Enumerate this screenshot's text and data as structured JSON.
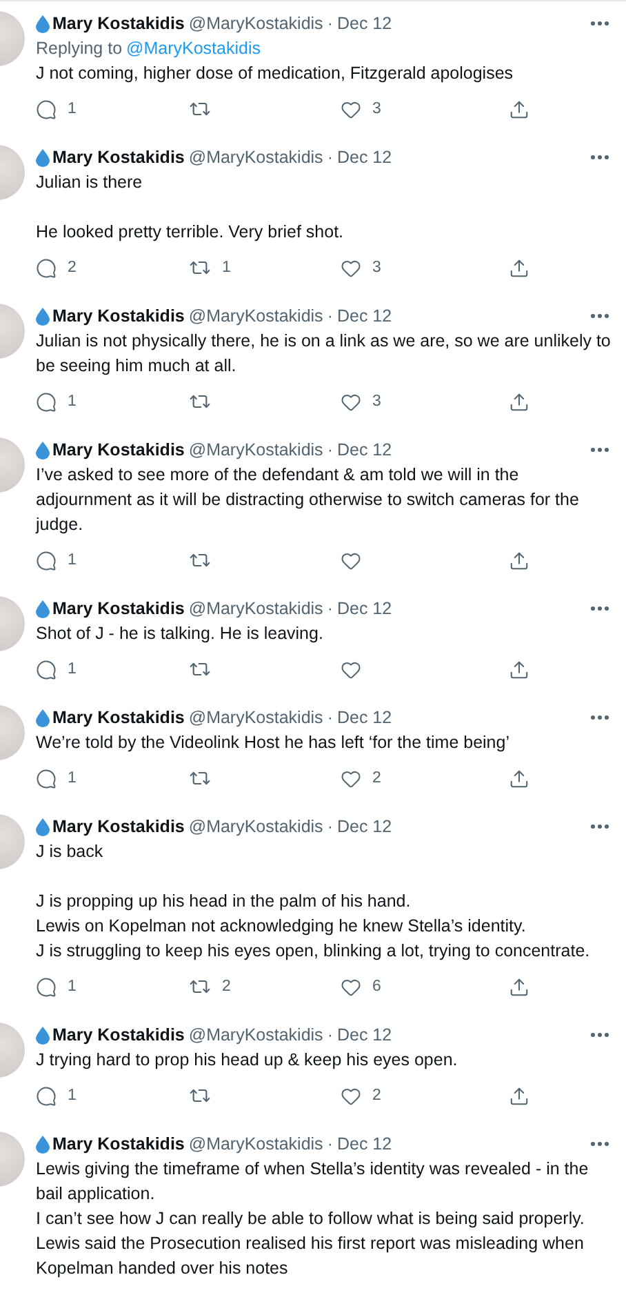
{
  "tweets": [
    {
      "author": "Mary Kostakidis",
      "handle": "@MaryKostakidis",
      "separator": "·",
      "date": "Dec 12",
      "reply_to": {
        "label": "Replying to",
        "handle": "@MaryKostakidis"
      },
      "paragraphs": [
        [
          "J not coming, higher dose of medication, Fitzgerald apologises"
        ]
      ],
      "replies": "1",
      "likes": "3"
    },
    {
      "author": "Mary Kostakidis",
      "handle": "@MaryKostakidis",
      "separator": "·",
      "date": "Dec 12",
      "paragraphs": [
        [
          "Julian is there"
        ],
        [
          "He looked pretty terrible. Very brief shot."
        ]
      ],
      "replies": "2",
      "retweets": "1",
      "likes": "3"
    },
    {
      "author": "Mary Kostakidis",
      "handle": "@MaryKostakidis",
      "separator": "·",
      "date": "Dec 12",
      "paragraphs": [
        [
          "Julian is not physically there, he is on a link as we are, so we are unlikely to",
          "be seeing him much at all."
        ]
      ],
      "replies": "1",
      "likes": "3"
    },
    {
      "author": "Mary Kostakidis",
      "handle": "@MaryKostakidis",
      "separator": "·",
      "date": "Dec 12",
      "paragraphs": [
        [
          "I’ve asked to see more of the defendant & am told we will in the",
          "adjournment as it will be distracting otherwise to switch cameras for the",
          "judge."
        ]
      ],
      "replies": "1"
    },
    {
      "author": "Mary Kostakidis",
      "handle": "@MaryKostakidis",
      "separator": "·",
      "date": "Dec 12",
      "paragraphs": [
        [
          "Shot of J - he is talking.  He is leaving."
        ]
      ],
      "replies": "1"
    },
    {
      "author": "Mary Kostakidis",
      "handle": "@MaryKostakidis",
      "separator": "·",
      "date": "Dec 12",
      "paragraphs": [
        [
          "We’re told by the Videolink Host he has left ‘for the time being’"
        ]
      ],
      "replies": "1",
      "likes": "2"
    },
    {
      "author": "Mary Kostakidis",
      "handle": "@MaryKostakidis",
      "separator": "·",
      "date": "Dec 12",
      "paragraphs": [
        [
          "J is back"
        ],
        [
          "J is propping up his head in the palm of his hand.",
          "Lewis on Kopelman not acknowledging he knew Stella’s identity.",
          "J is struggling to keep his eyes open, blinking a lot, trying to concentrate."
        ]
      ],
      "replies": "1",
      "retweets": "2",
      "likes": "6"
    },
    {
      "author": "Mary Kostakidis",
      "handle": "@MaryKostakidis",
      "separator": "·",
      "date": "Dec 12",
      "paragraphs": [
        [
          "J trying hard to prop his head up & keep his eyes open."
        ]
      ],
      "replies": "1",
      "likes": "2"
    },
    {
      "author": "Mary Kostakidis",
      "handle": "@MaryKostakidis",
      "separator": "·",
      "date": "Dec 12",
      "paragraphs": [
        [
          "Lewis giving the timeframe of when Stella’s identity was revealed - in the",
          "bail application.",
          "I can’t see how J can really be able to follow what is being said properly.",
          "Lewis said the Prosecution realised his first report was misleading when",
          "Kopelman handed over his notes"
        ]
      ]
    }
  ]
}
